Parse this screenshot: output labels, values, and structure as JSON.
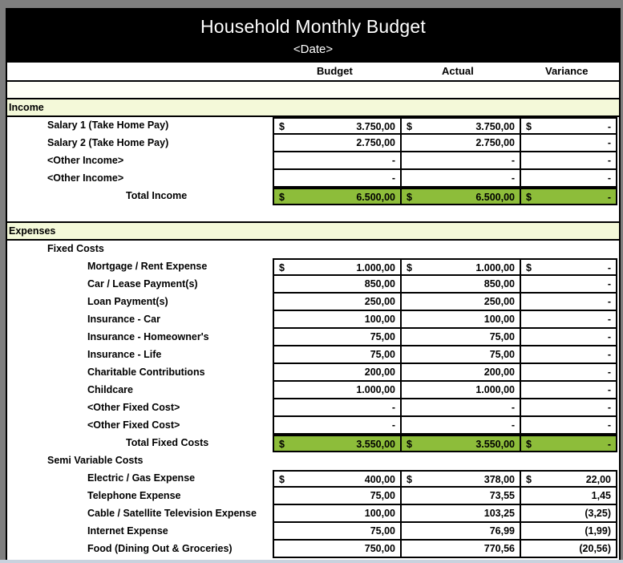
{
  "header": {
    "title": "Household Monthly Budget",
    "date": "<Date>"
  },
  "columns": {
    "budget": "Budget",
    "actual": "Actual",
    "variance": "Variance"
  },
  "currency_symbol": "$",
  "colors": {
    "title_band": "#000000",
    "section_fill": "#f4f9d9",
    "total_fill": "#8dbd3a"
  },
  "income": {
    "label": "Income",
    "rows": [
      {
        "label": "Salary 1 (Take Home Pay)",
        "budget": "3.750,00",
        "actual": "3.750,00",
        "variance": "-"
      },
      {
        "label": "Salary 2 (Take Home Pay)",
        "budget": "2.750,00",
        "actual": "2.750,00",
        "variance": "-"
      },
      {
        "label": "<Other Income>",
        "budget": "-",
        "actual": "-",
        "variance": "-"
      },
      {
        "label": "<Other Income>",
        "budget": "-",
        "actual": "-",
        "variance": "-"
      }
    ],
    "total": {
      "label": "Total Income",
      "budget": "6.500,00",
      "actual": "6.500,00",
      "variance": "-"
    }
  },
  "expenses": {
    "label": "Expenses",
    "fixed": {
      "label": "Fixed Costs",
      "rows": [
        {
          "label": "Mortgage / Rent Expense",
          "budget": "1.000,00",
          "actual": "1.000,00",
          "variance": "-"
        },
        {
          "label": "Car / Lease Payment(s)",
          "budget": "850,00",
          "actual": "850,00",
          "variance": "-"
        },
        {
          "label": "Loan Payment(s)",
          "budget": "250,00",
          "actual": "250,00",
          "variance": "-"
        },
        {
          "label": "Insurance - Car",
          "budget": "100,00",
          "actual": "100,00",
          "variance": "-"
        },
        {
          "label": "Insurance - Homeowner's",
          "budget": "75,00",
          "actual": "75,00",
          "variance": "-"
        },
        {
          "label": "Insurance - Life",
          "budget": "75,00",
          "actual": "75,00",
          "variance": "-"
        },
        {
          "label": "Charitable Contributions",
          "budget": "200,00",
          "actual": "200,00",
          "variance": "-"
        },
        {
          "label": "Childcare",
          "budget": "1.000,00",
          "actual": "1.000,00",
          "variance": "-"
        },
        {
          "label": "<Other Fixed Cost>",
          "budget": "-",
          "actual": "-",
          "variance": "-"
        },
        {
          "label": "<Other Fixed Cost>",
          "budget": "-",
          "actual": "-",
          "variance": "-"
        }
      ],
      "total": {
        "label": "Total Fixed Costs",
        "budget": "3.550,00",
        "actual": "3.550,00",
        "variance": "-"
      }
    },
    "semi_variable": {
      "label": "Semi Variable Costs",
      "rows": [
        {
          "label": "Electric / Gas Expense",
          "budget": "400,00",
          "actual": "378,00",
          "variance": "22,00"
        },
        {
          "label": "Telephone Expense",
          "budget": "75,00",
          "actual": "73,55",
          "variance": "1,45"
        },
        {
          "label": "Cable / Satellite Television Expense",
          "budget": "100,00",
          "actual": "103,25",
          "variance": "(3,25)"
        },
        {
          "label": "Internet Expense",
          "budget": "75,00",
          "actual": "76,99",
          "variance": "(1,99)"
        },
        {
          "label": "Food (Dining Out & Groceries)",
          "budget": "750,00",
          "actual": "770,56",
          "variance": "(20,56)"
        }
      ]
    }
  }
}
